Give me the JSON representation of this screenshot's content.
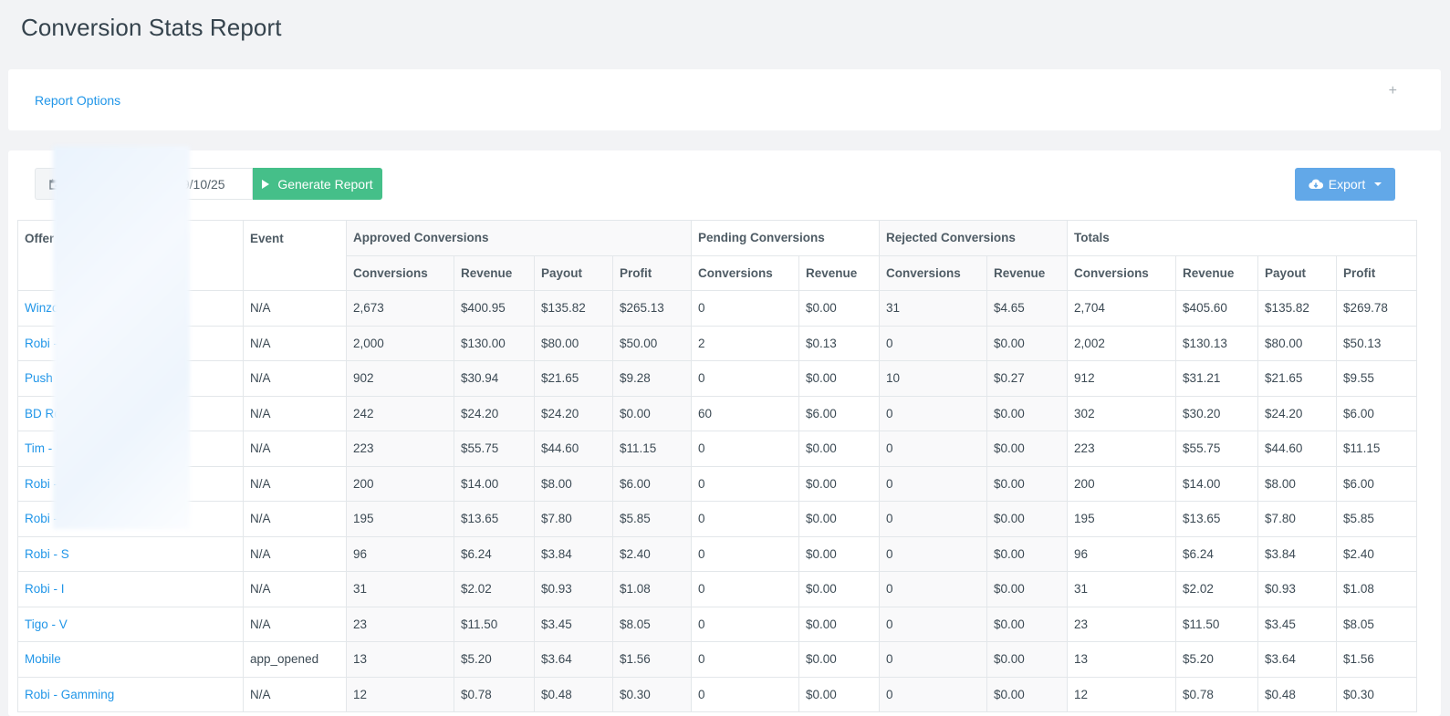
{
  "page": {
    "title": "Conversion Stats Report"
  },
  "report_options": {
    "label": "Report Options",
    "toggle_icon": "+"
  },
  "toolbar": {
    "calendar_icon": "calendar-icon",
    "date_range": "2019/10/25 - 2019/10/25",
    "generate_label": "Generate Report",
    "export_label": "Export"
  },
  "colors": {
    "link": "#2196e8",
    "generate_button": "#45bf89",
    "export_button": "#62a8e8"
  },
  "table": {
    "group_headers": {
      "offer": "Offer",
      "event": "Event",
      "approved": "Approved Conversions",
      "pending": "Pending Conversions",
      "rejected": "Rejected Conversions",
      "totals": "Totals"
    },
    "sub_headers": {
      "approved": [
        "Conversions",
        "Revenue",
        "Payout",
        "Profit"
      ],
      "pending": [
        "Conversions",
        "Revenue"
      ],
      "rejected": [
        "Conversions",
        "Revenue"
      ],
      "totals": [
        "Conversions",
        "Revenue",
        "Payout",
        "Profit"
      ]
    },
    "rows": [
      {
        "offer": "Winzo",
        "event": "N/A",
        "a_conv": "2,673",
        "a_rev": "$400.95",
        "a_pay": "$135.82",
        "a_profit": "$265.13",
        "p_conv": "0",
        "p_rev": "$0.00",
        "r_conv": "31",
        "r_rev": "$4.65",
        "t_conv": "2,704",
        "t_rev": "$405.60",
        "t_pay": "$135.82",
        "t_profit": "$269.78"
      },
      {
        "offer": "Robi - S",
        "event": "N/A",
        "a_conv": "2,000",
        "a_rev": "$130.00",
        "a_pay": "$80.00",
        "a_profit": "$50.00",
        "p_conv": "2",
        "p_rev": "$0.13",
        "r_conv": "0",
        "r_rev": "$0.00",
        "t_conv": "2,002",
        "t_rev": "$130.13",
        "t_pay": "$80.00",
        "t_profit": "$50.13"
      },
      {
        "offer": "Push -",
        "event": "N/A",
        "a_conv": "902",
        "a_rev": "$30.94",
        "a_pay": "$21.65",
        "a_profit": "$9.28",
        "p_conv": "0",
        "p_rev": "$0.00",
        "r_conv": "10",
        "r_rev": "$0.27",
        "t_conv": "912",
        "t_rev": "$31.21",
        "t_pay": "$21.65",
        "t_profit": "$9.55"
      },
      {
        "offer": "BD Rob",
        "event": "N/A",
        "a_conv": "242",
        "a_rev": "$24.20",
        "a_pay": "$24.20",
        "a_profit": "$0.00",
        "p_conv": "60",
        "p_rev": "$6.00",
        "r_conv": "0",
        "r_rev": "$0.00",
        "t_conv": "302",
        "t_rev": "$30.20",
        "t_pay": "$24.20",
        "t_profit": "$6.00"
      },
      {
        "offer": "Tim - F",
        "event": "N/A",
        "a_conv": "223",
        "a_rev": "$55.75",
        "a_pay": "$44.60",
        "a_profit": "$11.15",
        "p_conv": "0",
        "p_rev": "$0.00",
        "r_conv": "0",
        "r_rev": "$0.00",
        "t_conv": "223",
        "t_rev": "$55.75",
        "t_pay": "$44.60",
        "t_profit": "$11.15"
      },
      {
        "offer": "Robi - I",
        "event": "N/A",
        "a_conv": "200",
        "a_rev": "$14.00",
        "a_pay": "$8.00",
        "a_profit": "$6.00",
        "p_conv": "0",
        "p_rev": "$0.00",
        "r_conv": "0",
        "r_rev": "$0.00",
        "t_conv": "200",
        "t_rev": "$14.00",
        "t_pay": "$8.00",
        "t_profit": "$6.00"
      },
      {
        "offer": "Robi - I",
        "event": "N/A",
        "a_conv": "195",
        "a_rev": "$13.65",
        "a_pay": "$7.80",
        "a_profit": "$5.85",
        "p_conv": "0",
        "p_rev": "$0.00",
        "r_conv": "0",
        "r_rev": "$0.00",
        "t_conv": "195",
        "t_rev": "$13.65",
        "t_pay": "$7.80",
        "t_profit": "$5.85"
      },
      {
        "offer": "Robi - S",
        "event": "N/A",
        "a_conv": "96",
        "a_rev": "$6.24",
        "a_pay": "$3.84",
        "a_profit": "$2.40",
        "p_conv": "0",
        "p_rev": "$0.00",
        "r_conv": "0",
        "r_rev": "$0.00",
        "t_conv": "96",
        "t_rev": "$6.24",
        "t_pay": "$3.84",
        "t_profit": "$2.40"
      },
      {
        "offer": "Robi - I",
        "event": "N/A",
        "a_conv": "31",
        "a_rev": "$2.02",
        "a_pay": "$0.93",
        "a_profit": "$1.08",
        "p_conv": "0",
        "p_rev": "$0.00",
        "r_conv": "0",
        "r_rev": "$0.00",
        "t_conv": "31",
        "t_rev": "$2.02",
        "t_pay": "$0.93",
        "t_profit": "$1.08"
      },
      {
        "offer": "Tigo - V",
        "event": "N/A",
        "a_conv": "23",
        "a_rev": "$11.50",
        "a_pay": "$3.45",
        "a_profit": "$8.05",
        "p_conv": "0",
        "p_rev": "$0.00",
        "r_conv": "0",
        "r_rev": "$0.00",
        "t_conv": "23",
        "t_rev": "$11.50",
        "t_pay": "$3.45",
        "t_profit": "$8.05"
      },
      {
        "offer": "Mobile",
        "event": "app_opened",
        "a_conv": "13",
        "a_rev": "$5.20",
        "a_pay": "$3.64",
        "a_profit": "$1.56",
        "p_conv": "0",
        "p_rev": "$0.00",
        "r_conv": "0",
        "r_rev": "$0.00",
        "t_conv": "13",
        "t_rev": "$5.20",
        "t_pay": "$3.64",
        "t_profit": "$1.56"
      },
      {
        "offer": "Robi - Gamming",
        "event": "N/A",
        "a_conv": "12",
        "a_rev": "$0.78",
        "a_pay": "$0.48",
        "a_profit": "$0.30",
        "p_conv": "0",
        "p_rev": "$0.00",
        "r_conv": "0",
        "r_rev": "$0.00",
        "t_conv": "12",
        "t_rev": "$0.78",
        "t_pay": "$0.48",
        "t_profit": "$0.30"
      }
    ]
  }
}
